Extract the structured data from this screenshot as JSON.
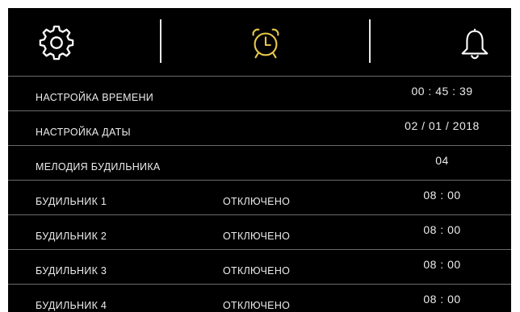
{
  "colors": {
    "background": "#000000",
    "text": "#ececec",
    "active_tab": "#e6c84a",
    "divider": "#6b6b6b"
  },
  "tabs": [
    {
      "icon": "gear-icon",
      "active": false
    },
    {
      "icon": "alarm-clock-icon",
      "active": true
    },
    {
      "icon": "bell-icon",
      "active": false
    }
  ],
  "settings": {
    "time": {
      "label": "НАСТРОЙКА ВРЕМЕНИ",
      "value": "00 : 45 : 39"
    },
    "date": {
      "label": "НАСТРОЙКА ДАТЫ",
      "value": "02 / 01 / 2018"
    },
    "melody": {
      "label": "МЕЛОДИЯ БУДИЛЬНИКА",
      "value": "04"
    }
  },
  "alarms": [
    {
      "label": "БУДИЛЬНИК 1",
      "status": "ОТКЛЮЧЕНО",
      "time": "08 : 00"
    },
    {
      "label": "БУДИЛЬНИК 2",
      "status": "ОТКЛЮЧЕНО",
      "time": "08 : 00"
    },
    {
      "label": "БУДИЛЬНИК 3",
      "status": "ОТКЛЮЧЕНО",
      "time": "08 : 00"
    },
    {
      "label": "БУДИЛЬНИК 4",
      "status": "ОТКЛЮЧЕНО",
      "time": "08 : 00"
    }
  ]
}
